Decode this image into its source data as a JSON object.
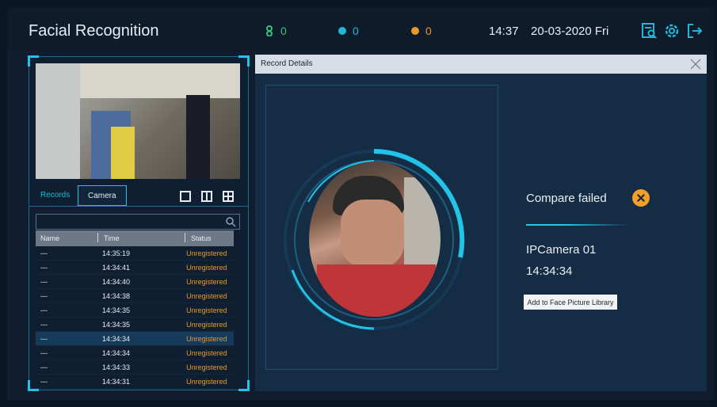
{
  "header": {
    "title": "Facial Recognition",
    "stats": {
      "users_count": "0",
      "matched_count": "0",
      "failed_count": "0"
    },
    "clock": "14:37",
    "date": "20-03-2020 Fri",
    "icons": [
      "search-record-icon",
      "gear-icon",
      "logout-icon"
    ]
  },
  "left_panel": {
    "tabs": [
      {
        "label": "Records"
      },
      {
        "label": "Camera"
      }
    ],
    "search": {
      "placeholder": "",
      "value": ""
    },
    "table": {
      "columns": [
        "Name",
        "Time",
        "Status"
      ],
      "rows": [
        {
          "name": "---",
          "time": "14:35:19",
          "status": "Unregistered"
        },
        {
          "name": "---",
          "time": "14:34:41",
          "status": "Unregistered"
        },
        {
          "name": "---",
          "time": "14:34:40",
          "status": "Unregistered"
        },
        {
          "name": "---",
          "time": "14:34:38",
          "status": "Unregistered"
        },
        {
          "name": "---",
          "time": "14:34:35",
          "status": "Unregistered"
        },
        {
          "name": "---",
          "time": "14:34:35",
          "status": "Unregistered"
        },
        {
          "name": "---",
          "time": "14:34:34",
          "status": "Unregistered"
        },
        {
          "name": "---",
          "time": "14:34:34",
          "status": "Unregistered"
        },
        {
          "name": "---",
          "time": "14:34:33",
          "status": "Unregistered"
        },
        {
          "name": "---",
          "time": "14:34:31",
          "status": "Unregistered"
        }
      ]
    }
  },
  "modal": {
    "title": "Record Details",
    "result": "Compare failed",
    "camera": "IPCamera 01",
    "time": "14:34:34",
    "add_button": "Add to Face Picture Library"
  },
  "colors": {
    "accent": "#22c3e6",
    "status_unregistered": "#e59a2c",
    "users_green": "#39c07a",
    "failed_orange": "#f2a02d"
  }
}
